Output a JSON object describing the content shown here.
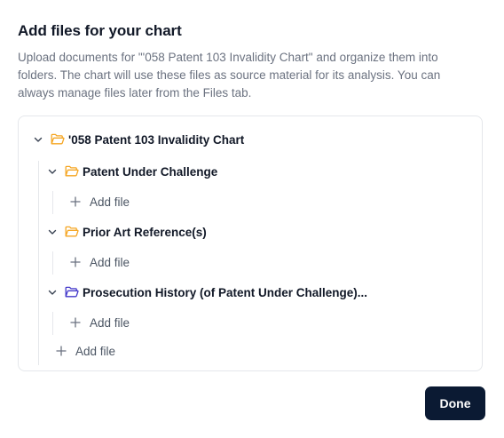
{
  "dialog": {
    "title": "Add files for your chart",
    "description": "Upload documents for \"'058 Patent 103 Invalidity Chart\" and organize them into folders. The chart will use these files as source material for its analysis. You can always manage files later from the Files tab.",
    "done_label": "Done"
  },
  "tree": {
    "root": {
      "label": "'058 Patent 103 Invalidity Chart",
      "icon": "folder-open-icon",
      "icon_color": "#f5a623",
      "add_file_label": "Add file"
    },
    "folders": [
      {
        "label": "Patent Under Challenge",
        "icon": "folder-open-icon",
        "icon_color": "#f5a623",
        "add_file_label": "Add file"
      },
      {
        "label": "Prior Art Reference(s)",
        "icon": "folder-open-icon",
        "icon_color": "#f5a623",
        "add_file_label": "Add file"
      },
      {
        "label": "Prosecution History (of Patent Under Challenge)...",
        "icon": "folder-open-icon",
        "icon_color": "#4338ca",
        "add_file_label": "Add file"
      }
    ]
  },
  "colors": {
    "primary_button": "#0b1a33",
    "muted_text": "#6b7280",
    "border": "#e5e7eb"
  }
}
